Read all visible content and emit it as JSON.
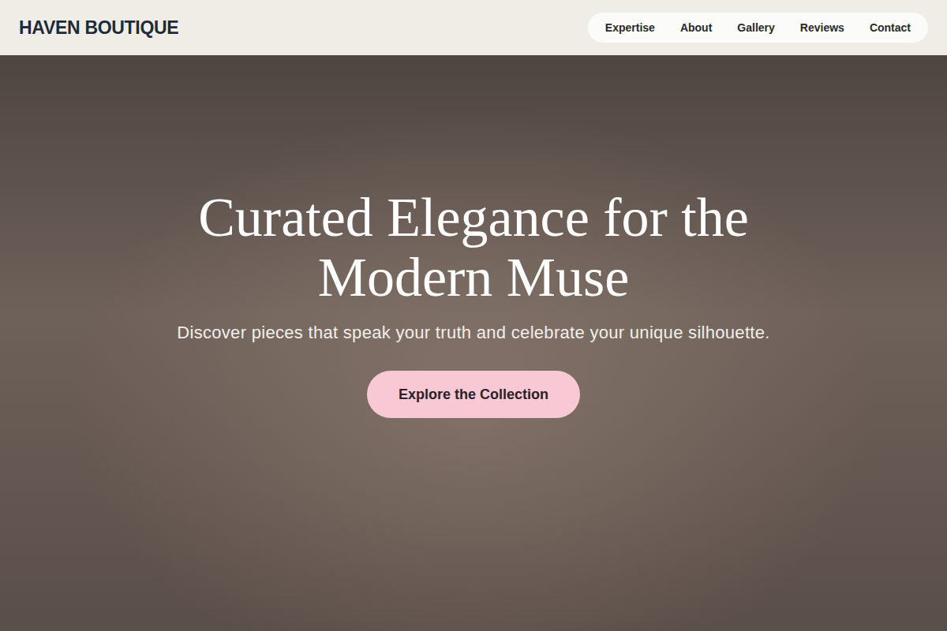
{
  "header": {
    "logo": "HAVEN BOUTIQUE",
    "nav": [
      "Expertise",
      "About",
      "Gallery",
      "Reviews",
      "Contact"
    ]
  },
  "hero": {
    "title": "Curated Elegance for the Modern Muse",
    "subtitle": "Discover pieces that speak your truth and celebrate your unique silhouette.",
    "cta": "Explore the Collection"
  }
}
